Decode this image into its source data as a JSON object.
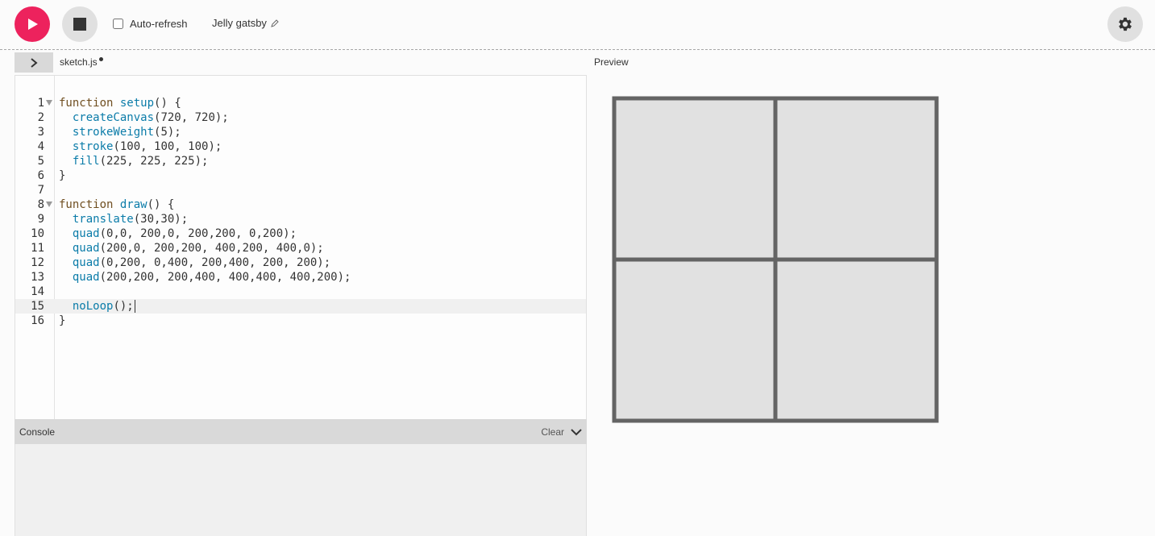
{
  "toolbar": {
    "play_icon": "play-icon",
    "stop_icon": "stop-icon",
    "auto_refresh_label": "Auto-refresh",
    "auto_refresh_checked": false,
    "project_name": "Jelly gatsby",
    "settings_icon": "gear-icon"
  },
  "colors": {
    "accent": "#ed225d",
    "canvas_stroke": "#646464",
    "canvas_fill": "#e1e1e1"
  },
  "editor": {
    "file_name": "sketch.js",
    "unsaved": true,
    "active_line": 15,
    "lines": [
      {
        "n": "1",
        "fold": true,
        "tokens": [
          {
            "t": "function",
            "c": "kw"
          },
          {
            "t": " "
          },
          {
            "t": "setup",
            "c": "fn"
          },
          {
            "t": "() {"
          }
        ]
      },
      {
        "n": "2",
        "tokens": [
          {
            "t": "  "
          },
          {
            "t": "createCanvas",
            "c": "fn"
          },
          {
            "t": "(720, 720);"
          }
        ]
      },
      {
        "n": "3",
        "tokens": [
          {
            "t": "  "
          },
          {
            "t": "strokeWeight",
            "c": "fn"
          },
          {
            "t": "(5);"
          }
        ]
      },
      {
        "n": "4",
        "tokens": [
          {
            "t": "  "
          },
          {
            "t": "stroke",
            "c": "fn"
          },
          {
            "t": "(100, 100, 100);"
          }
        ]
      },
      {
        "n": "5",
        "tokens": [
          {
            "t": "  "
          },
          {
            "t": "fill",
            "c": "fn"
          },
          {
            "t": "(225, 225, 225);"
          }
        ]
      },
      {
        "n": "6",
        "tokens": [
          {
            "t": "}"
          }
        ]
      },
      {
        "n": "7",
        "tokens": []
      },
      {
        "n": "8",
        "fold": true,
        "tokens": [
          {
            "t": "function",
            "c": "kw"
          },
          {
            "t": " "
          },
          {
            "t": "draw",
            "c": "fn"
          },
          {
            "t": "() {"
          }
        ]
      },
      {
        "n": "9",
        "tokens": [
          {
            "t": "  "
          },
          {
            "t": "translate",
            "c": "fn"
          },
          {
            "t": "(30,30);"
          }
        ]
      },
      {
        "n": "10",
        "tokens": [
          {
            "t": "  "
          },
          {
            "t": "quad",
            "c": "fn"
          },
          {
            "t": "(0,0, 200,0, 200,200, 0,200);"
          }
        ]
      },
      {
        "n": "11",
        "tokens": [
          {
            "t": "  "
          },
          {
            "t": "quad",
            "c": "fn"
          },
          {
            "t": "(200,0, 200,200, 400,200, 400,0);"
          }
        ]
      },
      {
        "n": "12",
        "tokens": [
          {
            "t": "  "
          },
          {
            "t": "quad",
            "c": "fn"
          },
          {
            "t": "(0,200, 0,400, 200,400, 200, 200);"
          }
        ]
      },
      {
        "n": "13",
        "tokens": [
          {
            "t": "  "
          },
          {
            "t": "quad",
            "c": "fn"
          },
          {
            "t": "(200,200, 200,400, 400,400, 400,200);"
          }
        ]
      },
      {
        "n": "14",
        "tokens": []
      },
      {
        "n": "15",
        "tokens": [
          {
            "t": "  "
          },
          {
            "t": "noLoop",
            "c": "fn"
          },
          {
            "t": "();"
          }
        ],
        "cursor": true
      },
      {
        "n": "16",
        "tokens": [
          {
            "t": "}"
          }
        ]
      }
    ]
  },
  "console": {
    "title": "Console",
    "clear_label": "Clear",
    "toggle_icon": "chevron-down-icon"
  },
  "preview": {
    "label": "Preview"
  }
}
